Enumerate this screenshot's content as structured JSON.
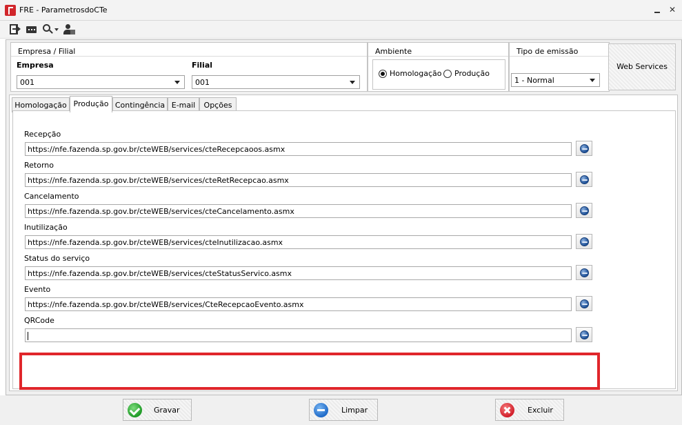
{
  "window": {
    "title": "FRE - ParametrosdoCTe",
    "minimize_glyph": "",
    "close_glyph": "✕"
  },
  "toolbar": {
    "icons": [
      "exit-icon",
      "message-icon",
      "search-icon",
      "user-icon"
    ]
  },
  "empresa_group": {
    "title": "Empresa / Filial",
    "empresa_label": "Empresa",
    "empresa_value": "001",
    "filial_label": "Filial",
    "filial_value": "001"
  },
  "ambiente_group": {
    "title": "Ambiente",
    "options": [
      {
        "label": "Homologação",
        "selected": true
      },
      {
        "label": "Produção",
        "selected": false
      }
    ]
  },
  "tipo_group": {
    "title": "Tipo de emissão",
    "value": "1 - Normal"
  },
  "web_services_button": "Web Services",
  "tabs": [
    {
      "label": "Homologação",
      "active": false
    },
    {
      "label": "Produção",
      "active": true
    },
    {
      "label": "Contingência",
      "active": false
    },
    {
      "label": "E-mail",
      "active": false
    },
    {
      "label": "Opções",
      "active": false
    }
  ],
  "fields": [
    {
      "label": "Recepção",
      "value": "https://nfe.fazenda.sp.gov.br/cteWEB/services/cteRecepcaoos.asmx"
    },
    {
      "label": "Retorno",
      "value": "https://nfe.fazenda.sp.gov.br/cteWEB/services/cteRetRecepcao.asmx"
    },
    {
      "label": "Cancelamento",
      "value": "https://nfe.fazenda.sp.gov.br/cteWEB/services/cteCancelamento.asmx"
    },
    {
      "label": "Inutilização",
      "value": "https://nfe.fazenda.sp.gov.br/cteWEB/services/cteInutilizacao.asmx"
    },
    {
      "label": "Status do serviço",
      "value": "https://nfe.fazenda.sp.gov.br/cteWEB/services/cteStatusServico.asmx"
    },
    {
      "label": "Evento",
      "value": "https://nfe.fazenda.sp.gov.br/cteWEB/services/CteRecepcaoEvento.asmx"
    },
    {
      "label": "QRCode",
      "value": ""
    }
  ],
  "colors": {
    "highlight": "#e0262b",
    "accent_blue": "#1d4f95"
  },
  "buttons": {
    "save": "Gravar",
    "clear": "Limpar",
    "delete": "Excluir"
  }
}
